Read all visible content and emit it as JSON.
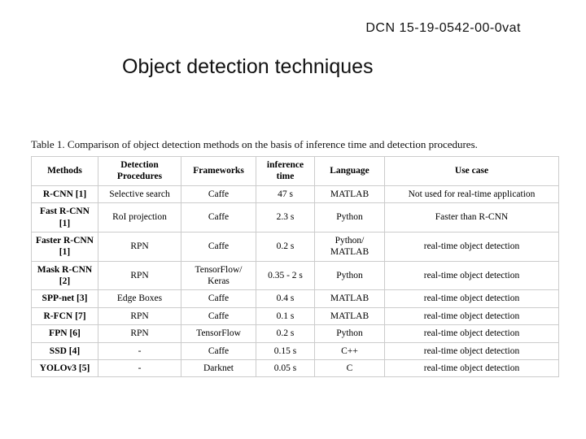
{
  "header": {
    "dcn": "DCN 15-19-0542-00-0vat",
    "title": "Object detection techniques"
  },
  "table": {
    "caption": "Table 1.  Comparison of object detection methods on the basis of inference time and detection procedures.",
    "columns": {
      "methods": "Methods",
      "procedures": "Detection Procedures",
      "frameworks": "Frameworks",
      "time": "inference time",
      "language": "Language",
      "usecase": "Use case"
    },
    "rows": [
      {
        "method": "R-CNN [1]",
        "proc": "Selective search",
        "frame": "Caffe",
        "time": "47 s",
        "lang": "MATLAB",
        "use": "Not used for real-time application"
      },
      {
        "method": "Fast R-CNN [1]",
        "proc": "RoI projection",
        "frame": "Caffe",
        "time": "2.3 s",
        "lang": "Python",
        "use": "Faster than R-CNN"
      },
      {
        "method": "Faster R-CNN [1]",
        "proc": "RPN",
        "frame": "Caffe",
        "time": "0.2 s",
        "lang": "Python/ MATLAB",
        "use": "real-time object detection"
      },
      {
        "method": "Mask R-CNN [2]",
        "proc": "RPN",
        "frame": "TensorFlow/ Keras",
        "time": "0.35 - 2 s",
        "lang": "Python",
        "use": "real-time object detection"
      },
      {
        "method": "SPP-net [3]",
        "proc": "Edge Boxes",
        "frame": "Caffe",
        "time": "0.4 s",
        "lang": "MATLAB",
        "use": "real-time object detection"
      },
      {
        "method": "R-FCN [7]",
        "proc": "RPN",
        "frame": "Caffe",
        "time": "0.1 s",
        "lang": "MATLAB",
        "use": "real-time object detection"
      },
      {
        "method": "FPN [6]",
        "proc": "RPN",
        "frame": "TensorFlow",
        "time": "0.2 s",
        "lang": "Python",
        "use": "real-time object detection"
      },
      {
        "method": "SSD [4]",
        "proc": "-",
        "frame": "Caffe",
        "time": "0.15 s",
        "lang": "C++",
        "use": "real-time object detection"
      },
      {
        "method": "YOLOv3 [5]",
        "proc": "-",
        "frame": "Darknet",
        "time": "0.05 s",
        "lang": "C",
        "use": "real-time object detection"
      }
    ]
  }
}
